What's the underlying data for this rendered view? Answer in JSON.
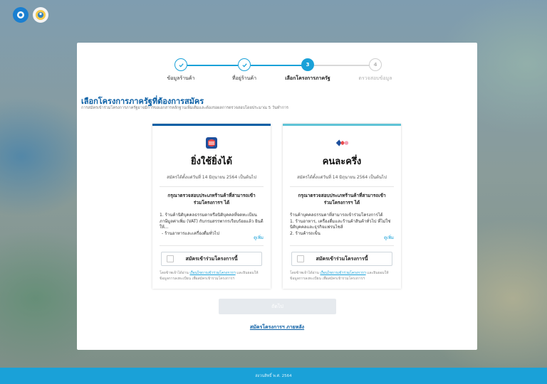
{
  "stepper": {
    "steps": [
      {
        "label": "ข้อมูลร้านค้า",
        "state": "done",
        "number": "1"
      },
      {
        "label": "ที่อยู่ร้านค้า",
        "state": "done",
        "number": "2"
      },
      {
        "label": "เลือกโครงการภาครัฐ",
        "state": "active",
        "number": "3"
      },
      {
        "label": "ตรวจสอบข้อมูล",
        "state": "todo",
        "number": "4"
      }
    ]
  },
  "main": {
    "title": "เลือกโครงการภาครัฐที่ต้องการสมัคร",
    "subtitle": "การสมัครเข้าร่วมโครงการภาครัฐอาจมีการขอเอกสารหลักฐานเพิ่มเติมและต้องรอผลการตรวจสอบโดยประมาณ 5 วันทำการ"
  },
  "cards": [
    {
      "name": "ยิ่งใช้ยิ่งได้",
      "date": "สมัครได้ตั้งแต่วันที่ 14 มิถุนายน 2564 เป็นต้นไป",
      "check_title": "กรุณาตรวจสอบประเภทร้านค้าที่สามารถเข้าร่วมโครงการฯ ได้",
      "desc_lines": [
        "1. ร้านค้านิติบุคคลธรรมดาหรือนิติบุคคลที่จดทะเบียนภาษีมูลค่าเพิ่ม (VAT) กับกรมสรรพากรเรียบร้อยแล้ว ยินดีให้...",
        "- ร้านอาหารและเครื่องดื่มทั่วไป"
      ],
      "more": "ดูเพิ่ม",
      "apply_label": "สมัครเข้าร่วมโครงการนี้",
      "terms_prefix": "โดยข้าพเจ้าได้อ่าน ",
      "terms_link": "เงื่อนไขการเข้าร่วมโครงการฯ",
      "terms_suffix": " และยินยอมให้ข้อมูลการลงทะเบียน เพื่อสมัครเข้าร่วมโครงการฯ"
    },
    {
      "name": "คนละครึ่ง",
      "date": "สมัครได้ตั้งแต่วันที่ 14 มิถุนายน 2564 เป็นต้นไป",
      "check_title": "กรุณาตรวจสอบประเภทร้านค้าที่สามารถเข้าร่วมโครงการฯ ได้",
      "desc_lines": [
        "ร้านค้าบุคคลธรรมดาที่สามารถเข้าร่วมโครงการได้",
        "1. ร้านอาหาร, เครื่องดื่มและร้านค้าสินค้าทั่วไป ที่ไม่ใช่นิติบุคคลและธุรกิจแฟรนไชส์",
        "2. ร้านค้ารถเข็น"
      ],
      "more": "ดูเพิ่ม",
      "apply_label": "สมัครเข้าร่วมโครงการนี้",
      "terms_prefix": "โดยข้าพเจ้าได้อ่าน ",
      "terms_link": "เงื่อนไขการเข้าร่วมโครงการฯ",
      "terms_suffix": " และยินยอมให้ข้อมูลการลงทะเบียน เพื่อสมัครเข้าร่วมโครงการฯ"
    }
  ],
  "actions": {
    "next_label": "ถัดไป",
    "later_label": "สมัครโครงการฯ ภายหลัง"
  },
  "footer": {
    "copyright": "สงวนสิทธิ์ พ.ศ. 2564"
  },
  "colors": {
    "accent": "#1aa1d8",
    "title_blue": "#0b5fa5",
    "footer_bg": "#1aa1d8"
  }
}
